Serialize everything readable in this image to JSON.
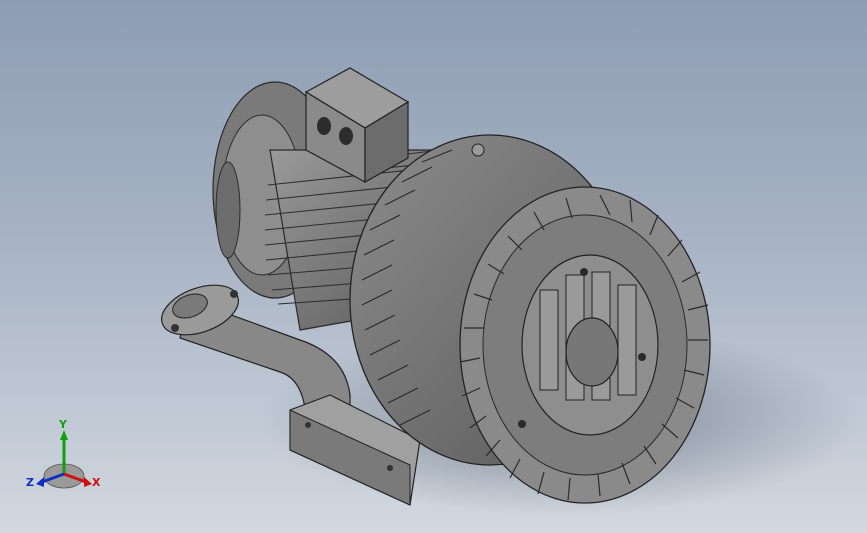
{
  "viewport": {
    "background_top": "#8d9db4",
    "background_bottom": "#d2d8e0"
  },
  "model": {
    "body_color": "#808080",
    "dark_color": "#3c3c3c"
  },
  "triad": {
    "x_label": "X",
    "y_label": "Y",
    "z_label": "Z",
    "x_color": "#d01010",
    "y_color": "#10a010",
    "z_color": "#1030c0"
  }
}
